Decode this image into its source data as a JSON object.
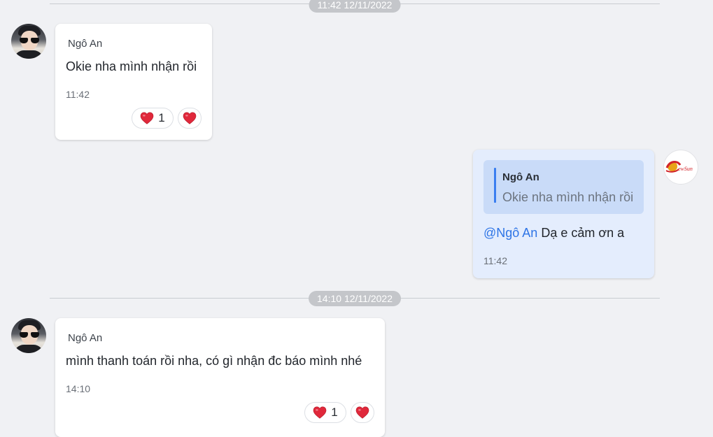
{
  "date_separators": [
    "11:42 12/11/2022",
    "14:10 12/11/2022"
  ],
  "messages": [
    {
      "sender": "Ngô An",
      "text": "Okie nha mình nhận rồi",
      "time": "11:42",
      "reaction_count": "1"
    },
    {
      "quote_sender": "Ngô An",
      "quote_text": "Okie nha mình nhận rồi",
      "mention": "@Ngô An",
      "text": " Dạ e cảm ơn a",
      "time": "11:42",
      "brand_logo_text": "ewSun"
    },
    {
      "sender": "Ngô An",
      "text": "mình thanh toán rồi nha, có gì nhận đc báo mình nhé",
      "time": "14:10",
      "reaction_count": "1"
    }
  ],
  "colors": {
    "background": "#f0f1f4",
    "own_bubble": "#e4edfd",
    "mention": "#2d74e6",
    "heart": "#e0283b"
  },
  "icons": [
    "heart-icon",
    "user-avatar",
    "brand-logo-avatar"
  ]
}
